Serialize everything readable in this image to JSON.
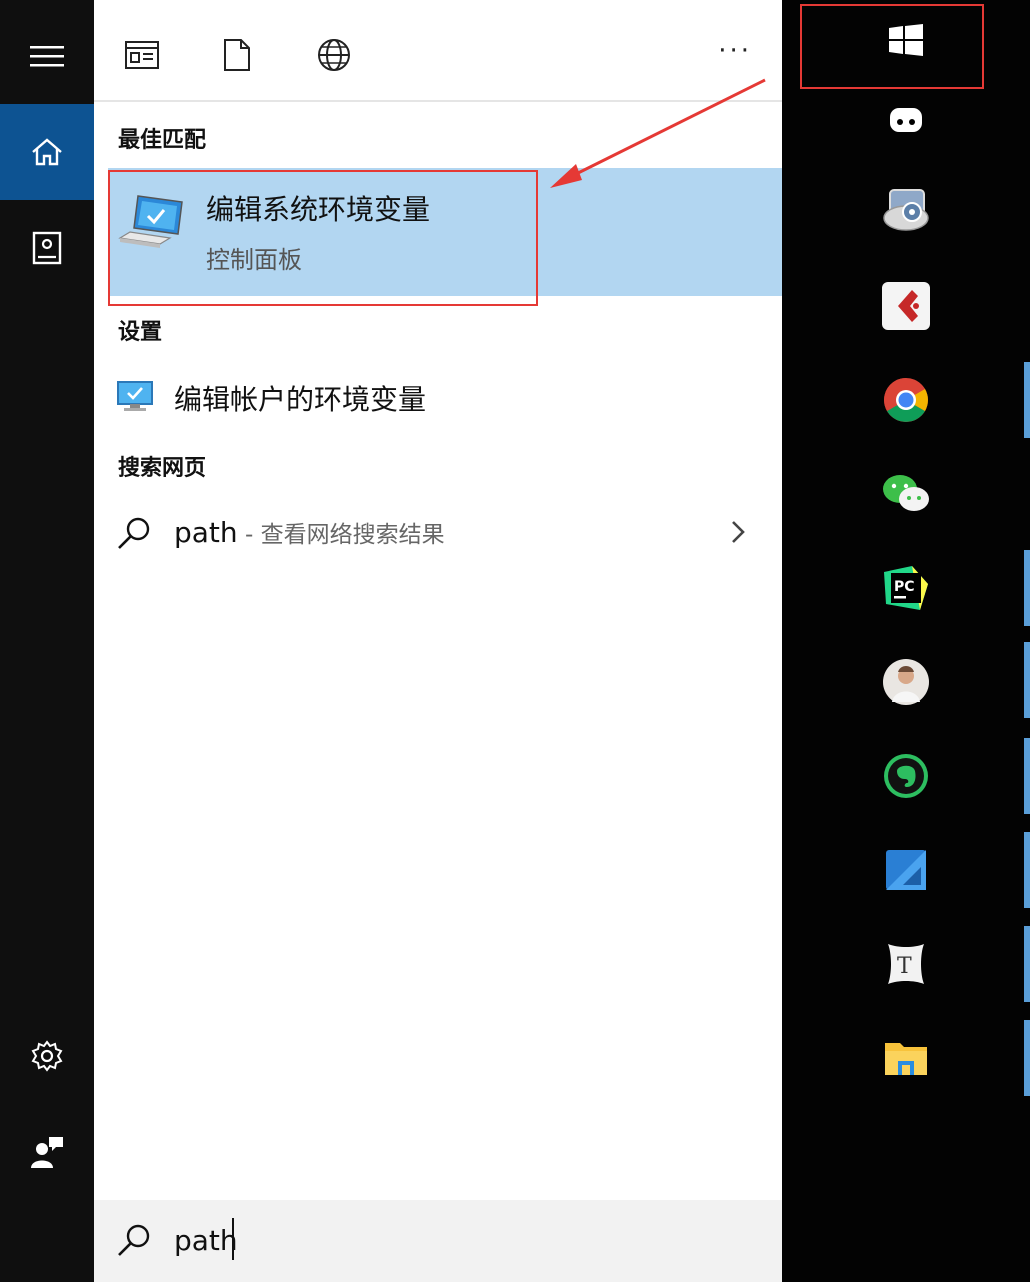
{
  "search_panel": {
    "toolbar": {
      "icons": [
        "apps-icon",
        "document-icon",
        "web-icon"
      ],
      "more_label": "···"
    },
    "best_match": {
      "section_title": "最佳匹配",
      "title": "编辑系统环境变量",
      "subtitle": "控制面板"
    },
    "settings": {
      "section_title": "设置",
      "item_label": "编辑帐户的环境变量"
    },
    "web": {
      "section_title": "搜索网页",
      "query": "path",
      "suffix": " - 查看网络搜索结果"
    },
    "search_box": {
      "value": "path"
    }
  },
  "left_rail": {
    "items": [
      "menu-icon",
      "home-icon",
      "notebook-icon",
      "settings-icon",
      "feedback-icon"
    ]
  },
  "taskbar": {
    "items": [
      "start-button",
      "app-icon",
      "media-app-icon",
      "cuda-app-icon",
      "chrome-icon",
      "wechat-icon",
      "pycharm-icon",
      "avatar-app-icon",
      "evernote-icon",
      "blue-app-icon",
      "typora-icon",
      "file-explorer-icon"
    ],
    "chrome_letter": "PC",
    "typora_letter": "T"
  },
  "colors": {
    "accent": "#0d5392",
    "highlight": "#b2d6f1",
    "annotation": "#e53935"
  }
}
